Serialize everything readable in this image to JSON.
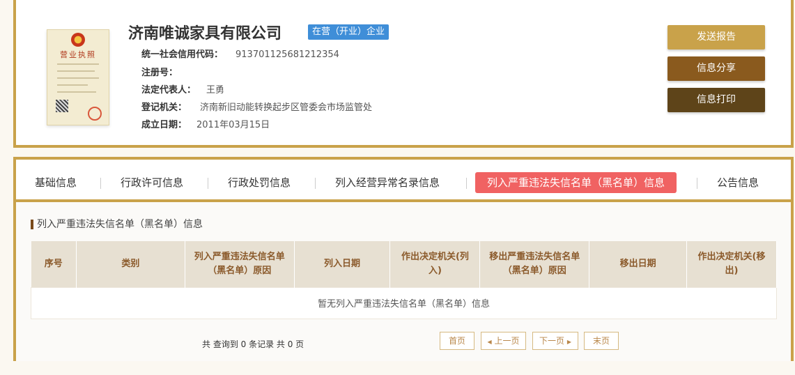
{
  "company": {
    "name": "济南唯诚家具有限公司",
    "status": "在营（开业）企业",
    "license_title": "营业执照",
    "fields": [
      {
        "label": "统一社会信用代码：",
        "value": "913701125681212354"
      },
      {
        "label": "注册号：",
        "value": ""
      },
      {
        "label": "法定代表人：",
        "value": "王勇"
      },
      {
        "label": "登记机关：",
        "value": "济南新旧动能转换起步区管委会市场监管处"
      },
      {
        "label": "成立日期：",
        "value": "2011年03月15日"
      }
    ]
  },
  "actions": {
    "send_report": "发送报告",
    "share": "信息分享",
    "print": "信息打印"
  },
  "tabs": [
    {
      "label": "基础信息"
    },
    {
      "label": "行政许可信息"
    },
    {
      "label": "行政处罚信息"
    },
    {
      "label": "列入经营异常名录信息"
    },
    {
      "label": "列入严重违法失信名单（黑名单）信息",
      "active": true
    },
    {
      "label": "公告信息"
    }
  ],
  "section": {
    "title": "列入严重违法失信名单（黑名单）信息",
    "columns": [
      "序号",
      "类别",
      "列入严重违法失信名单（黑名单）原因",
      "列入日期",
      "作出决定机关(列入)",
      "移出严重违法失信名单（黑名单）原因",
      "移出日期",
      "作出决定机关(移出)"
    ],
    "empty_text": "暂无列入严重违法失信名单（黑名单）信息",
    "record_summary": "共 查询到 0 条记录 共 0 页"
  },
  "pager": {
    "first": "首页",
    "prev": "上一页",
    "next": "下一页",
    "last": "末页"
  },
  "colors": {
    "gold_border": "#c9a24a",
    "badge_blue": "#3f8ed8",
    "active_tab": "#f06262",
    "btn_send": "#c9a24a",
    "btn_share": "#8a5a1e",
    "btn_print": "#5e4419",
    "header_bg": "#e7e0d2"
  },
  "icons": {
    "prev": "triangle-left-icon",
    "next": "triangle-right-icon"
  }
}
